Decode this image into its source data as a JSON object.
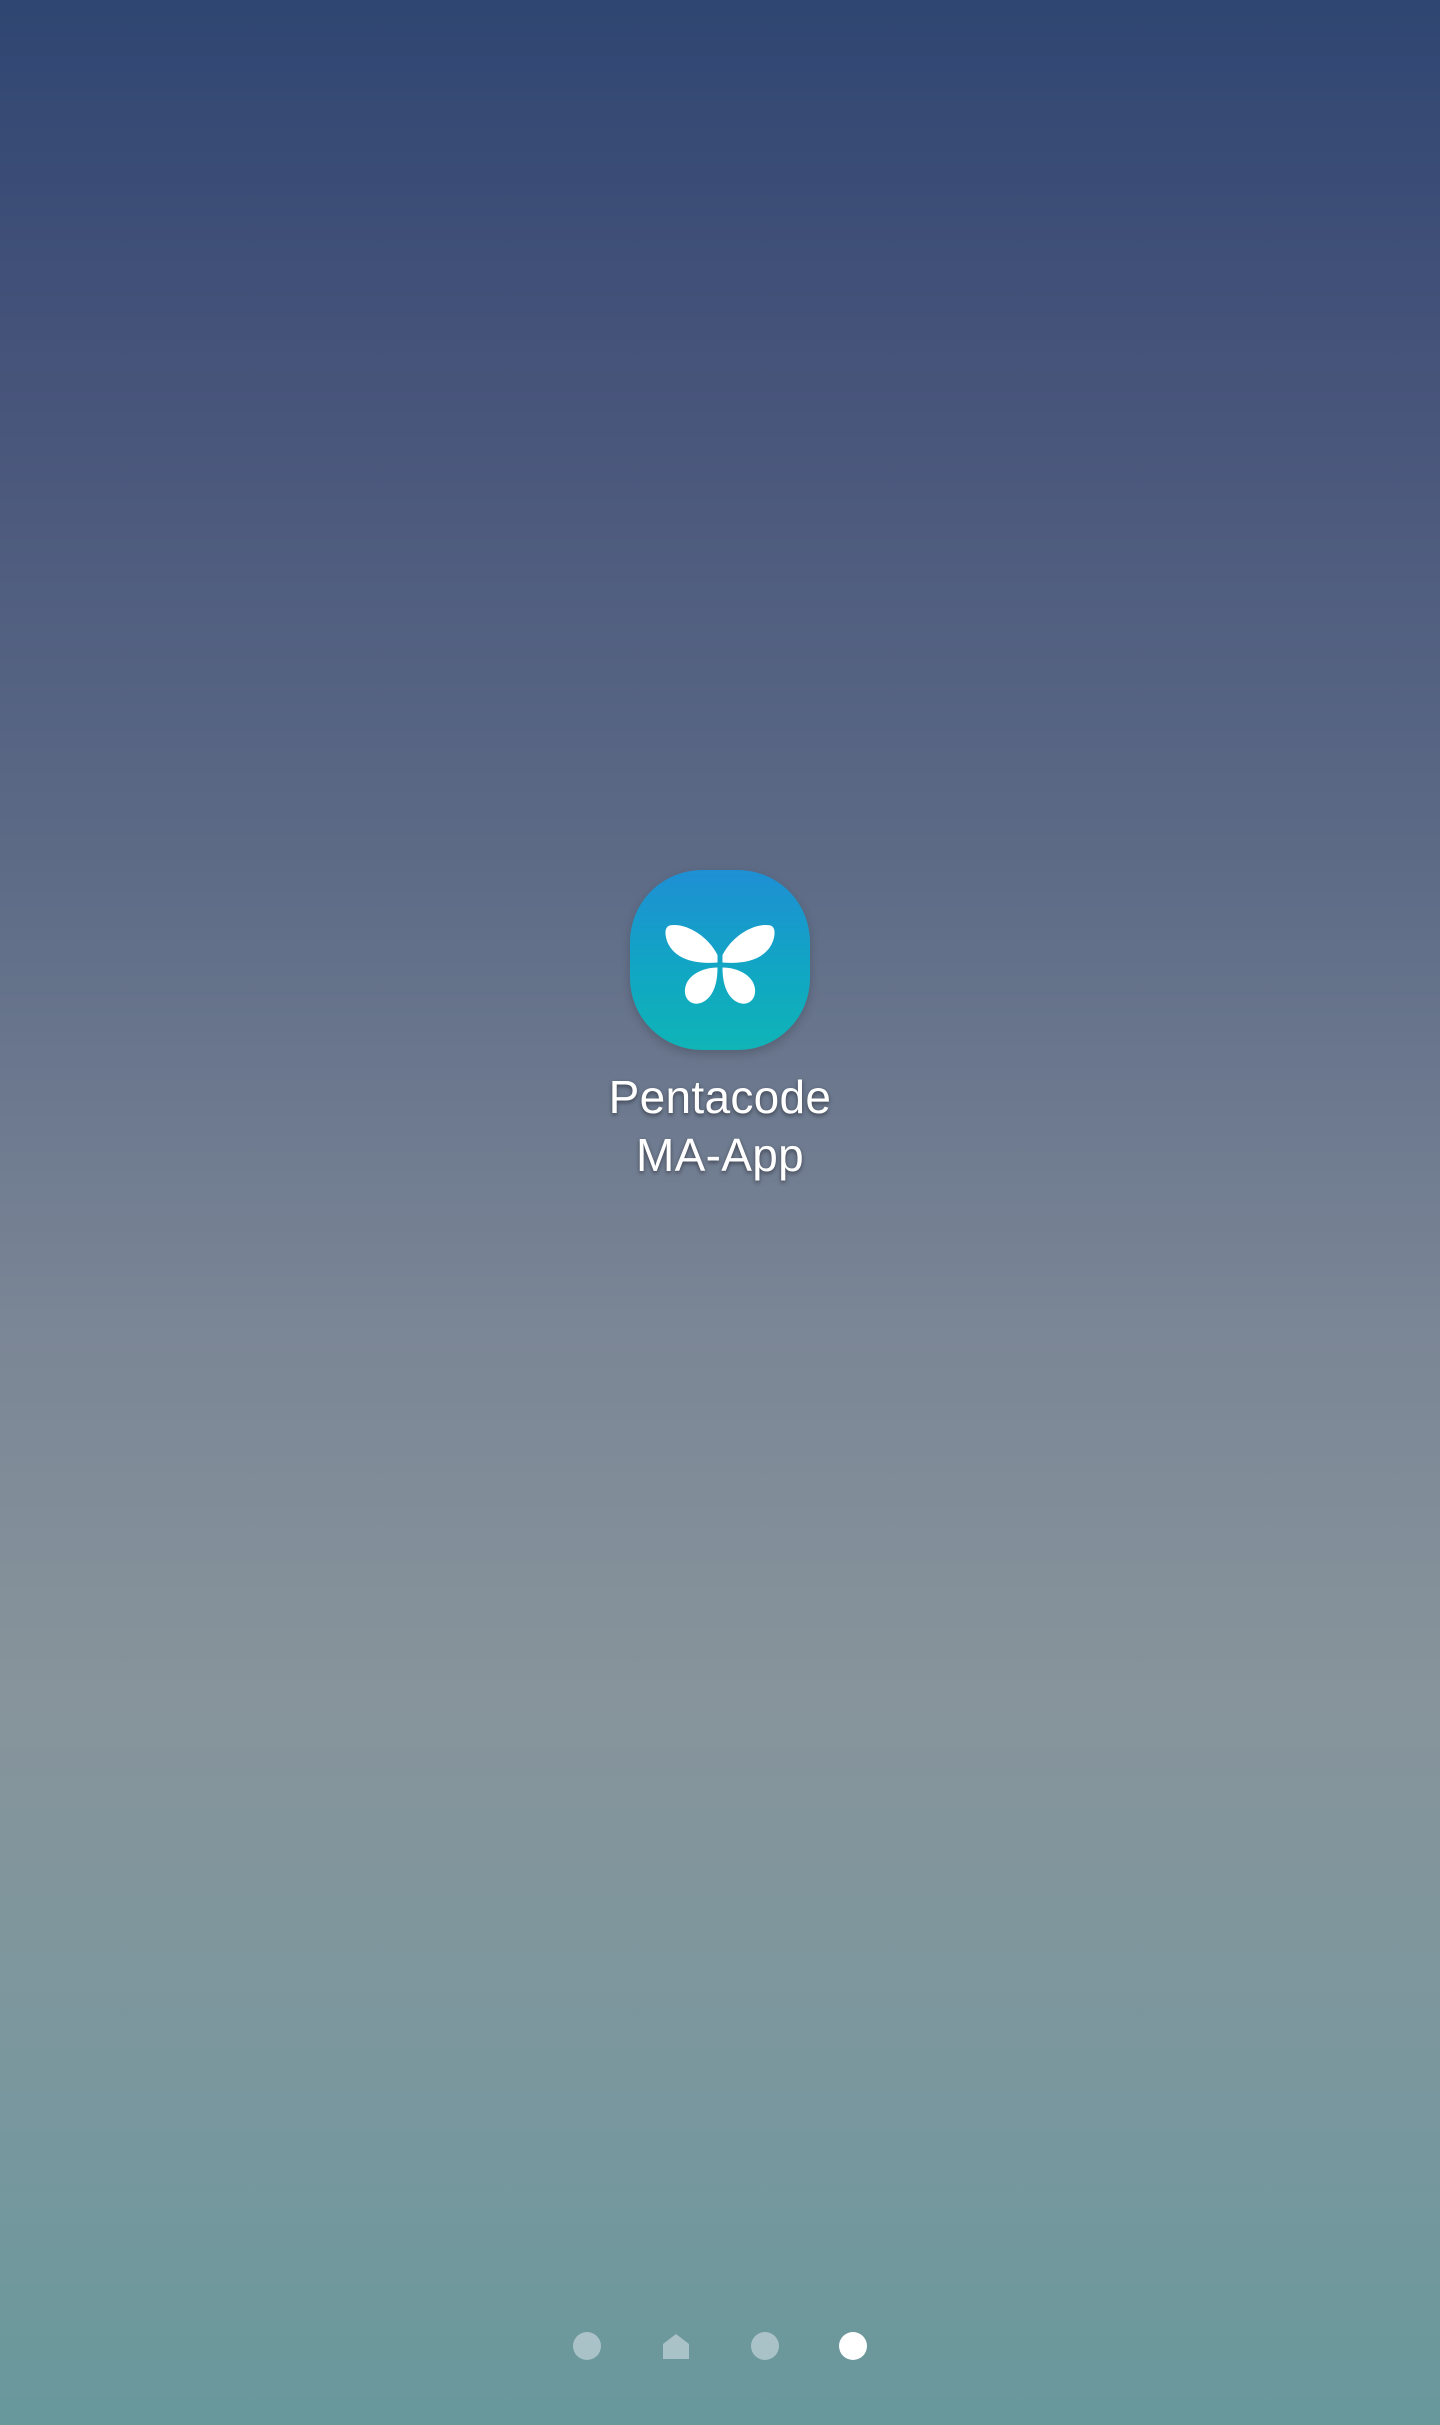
{
  "app": {
    "label_line1": "Pentacode",
    "label_line2": "MA-App",
    "icon": "butterfly-icon",
    "icon_gradient_top": "#1e8fd4",
    "icon_gradient_bottom": "#0fb4b7"
  },
  "page_indicator": {
    "pages": [
      {
        "type": "dot",
        "active": false
      },
      {
        "type": "home-icon",
        "active": false
      },
      {
        "type": "dot",
        "active": false
      },
      {
        "type": "dot",
        "active": true
      }
    ],
    "active_index": 3
  },
  "colors": {
    "wallpaper_top": "#2f4672",
    "wallpaper_bottom": "#68989c",
    "indicator_active": "#ffffff"
  }
}
